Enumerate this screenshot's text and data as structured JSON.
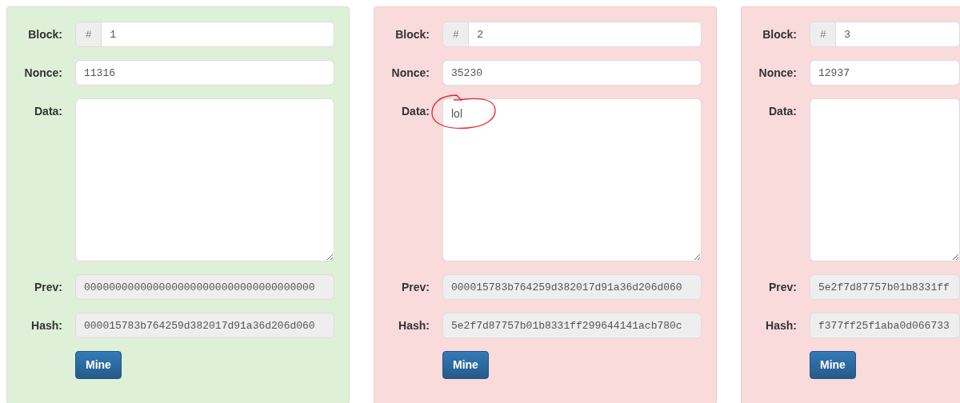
{
  "blocks": [
    {
      "valid": true,
      "labels": {
        "block": "Block:",
        "nonce": "Nonce:",
        "data": "Data:",
        "prev": "Prev:",
        "hash": "Hash:"
      },
      "block_prefix": "#",
      "block": "1",
      "nonce": "11316",
      "data_circled": false,
      "prev": "0000000000000000000000000000000000000",
      "hash": "000015783b764259d382017d91a36d206d060",
      "button": "Mine"
    },
    {
      "valid": false,
      "labels": {
        "block": "Block:",
        "nonce": "Nonce:",
        "data": "Data:",
        "prev": "Prev:",
        "hash": "Hash:"
      },
      "block_prefix": "#",
      "block": "2",
      "nonce": "35230",
      "data": "lol",
      "data_circled": true,
      "prev": "000015783b764259d382017d91a36d206d060",
      "hash": "5e2f7d87757b01b8331ff299644141acb780c",
      "button": "Mine"
    },
    {
      "valid": false,
      "labels": {
        "block": "Block:",
        "nonce": "Nonce:",
        "data": "Data:",
        "prev": "Prev:",
        "hash": "Hash:"
      },
      "block_prefix": "#",
      "block": "3",
      "nonce": "12937",
      "data_circled": false,
      "prev": "5e2f7d87757b01b8331ff",
      "hash": "f377ff25f1aba0d066733",
      "button": "Mine"
    }
  ]
}
